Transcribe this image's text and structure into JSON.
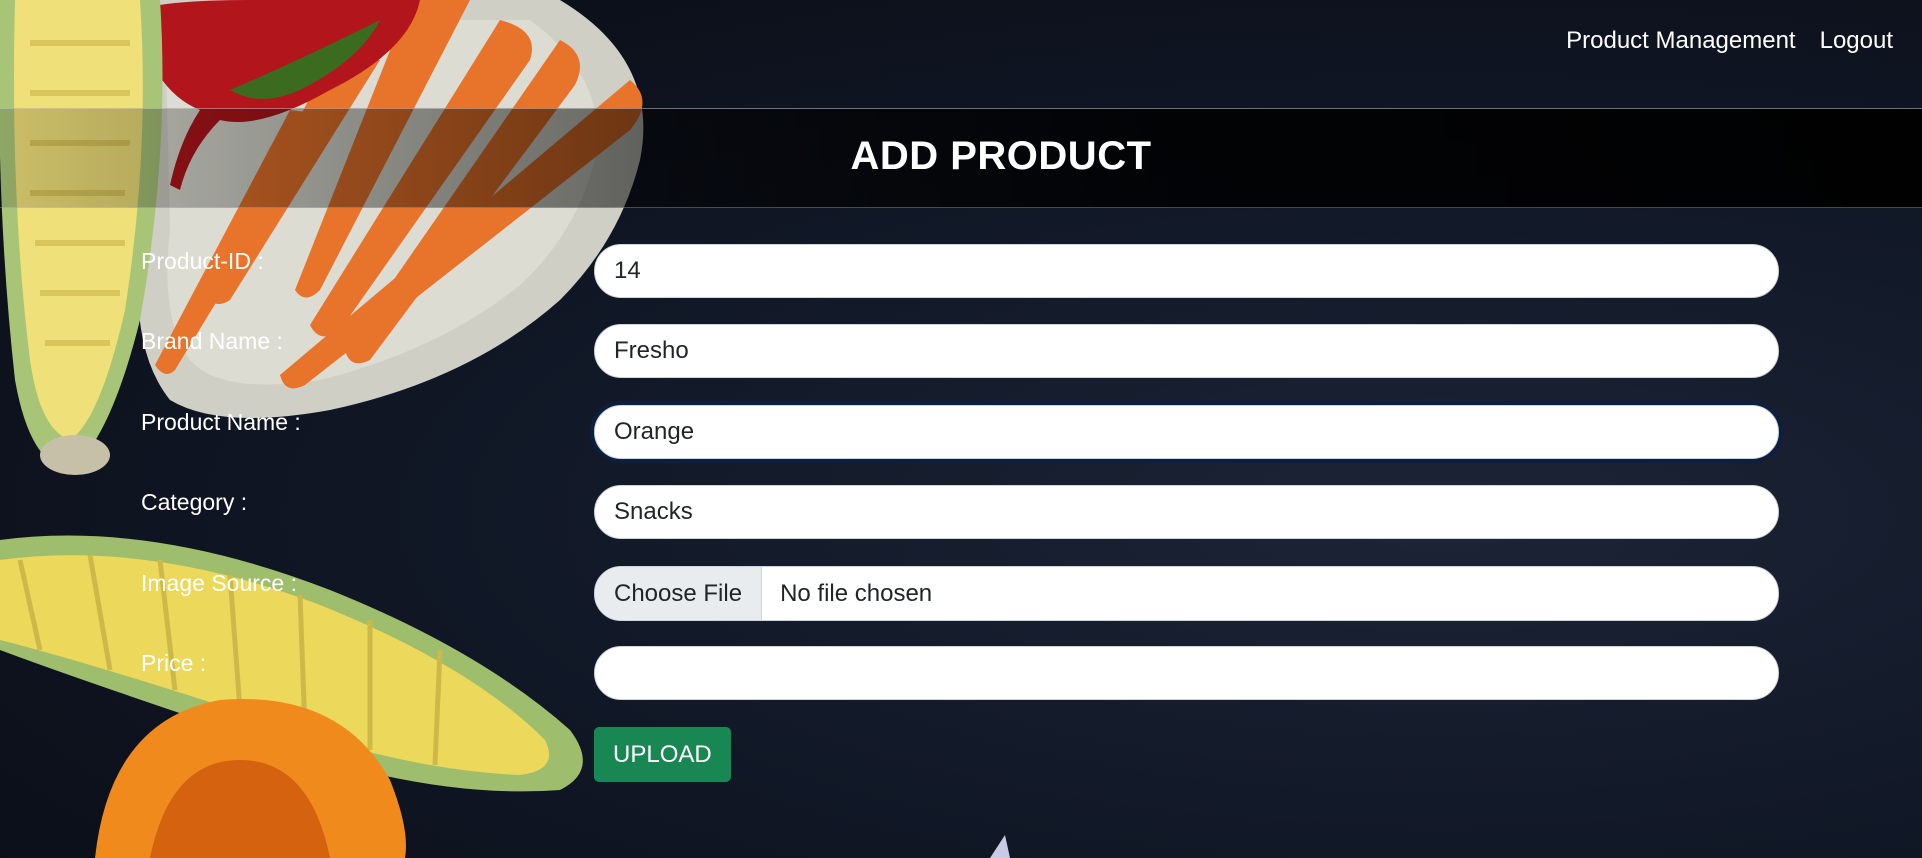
{
  "nav": {
    "product_management": "Product Management",
    "logout": "Logout"
  },
  "page_title": "ADD PRODUCT",
  "form": {
    "product_id": {
      "label": "Product-ID :",
      "value": "14"
    },
    "brand_name": {
      "label": "Brand Name :",
      "value": "Fresho"
    },
    "product_name": {
      "label": "Product Name :",
      "value": "Orange"
    },
    "category": {
      "label": "Category :",
      "value": "Snacks"
    },
    "image_source": {
      "label": "Image Source :",
      "button_label": "Choose File",
      "status": "No file chosen"
    },
    "price": {
      "label": "Price :",
      "value": ""
    },
    "upload_label": "UPLOAD"
  },
  "colors": {
    "background": "#111827",
    "upload_button": "#198754",
    "focus_ring": "#0d1e3e"
  }
}
